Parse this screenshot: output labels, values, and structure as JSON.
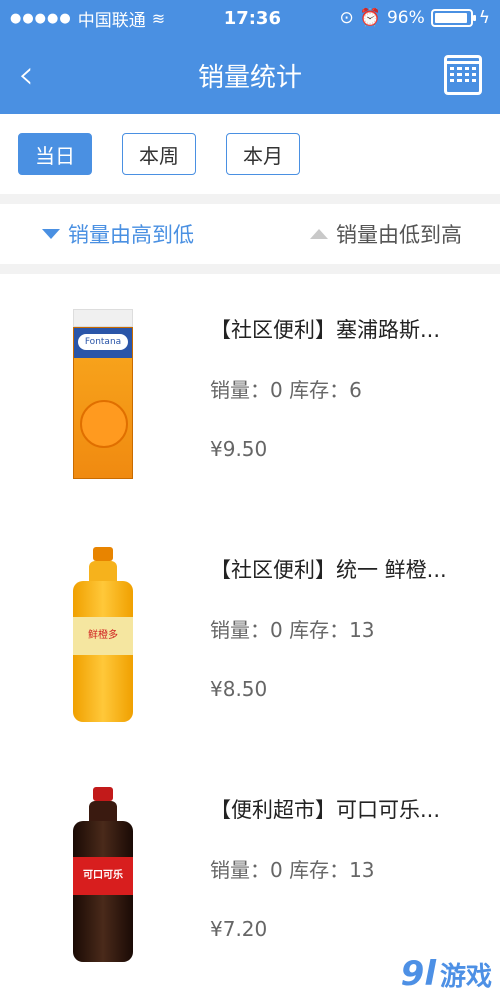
{
  "status_bar": {
    "signal": "●●●●●",
    "carrier": "中国联通",
    "time": "17:36",
    "battery_text": "96%",
    "battery_level": 0.96
  },
  "nav": {
    "title": "销量统计",
    "back_icon": "chevron-left-icon",
    "calendar_icon": "calendar-icon"
  },
  "filters": [
    {
      "label": "当日",
      "active": true
    },
    {
      "label": "本周",
      "active": false
    },
    {
      "label": "本月",
      "active": false
    }
  ],
  "sort": {
    "desc_label": "销量由高到低",
    "asc_label": "销量由低到高"
  },
  "products": [
    {
      "title": "【社区便利】塞浦路斯...",
      "stats": "销量：0 库存：6",
      "price": "¥9.50",
      "image": "orange-juice-carton"
    },
    {
      "title": "【社区便利】统一 鲜橙...",
      "stats": "销量：0 库存：13",
      "price": "¥8.50",
      "image": "orange-drink-bottle"
    },
    {
      "title": "【便利超市】可口可乐...",
      "stats": "销量：0 库存：13",
      "price": "¥7.20",
      "image": "cola-bottle"
    }
  ],
  "watermark": {
    "badge": "9l",
    "text": "游戏"
  },
  "colors": {
    "accent": "#4a90e2"
  }
}
